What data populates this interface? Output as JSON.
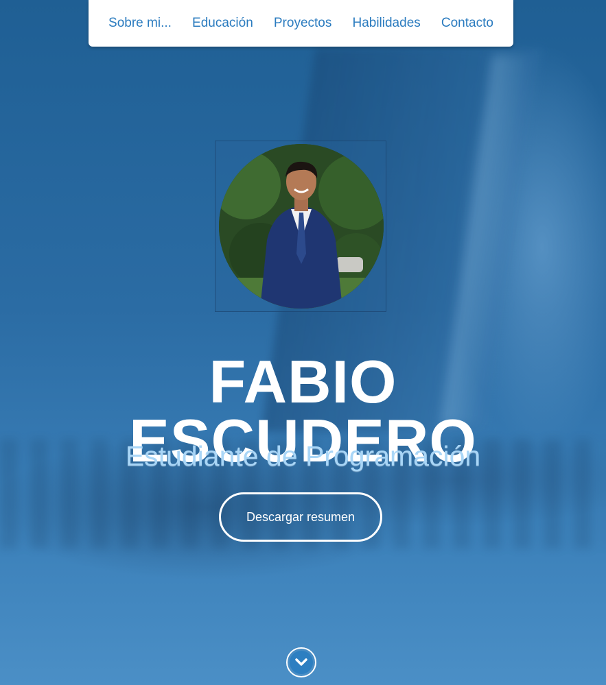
{
  "nav": {
    "items": [
      {
        "label": "Sobre mi..."
      },
      {
        "label": "Educación"
      },
      {
        "label": "Proyectos"
      },
      {
        "label": "Habilidades"
      },
      {
        "label": "Contacto"
      }
    ]
  },
  "hero": {
    "first_name": "FABIO",
    "last_name": "ESCUDERO",
    "subtitle": "Estudiante de Programación",
    "button_label": "Descargar resumen",
    "profile_icon": "profile-photo",
    "scroll_icon": "chevron-down-icon"
  },
  "colors": {
    "nav_link": "#2a7bbf",
    "subtitle": "#a9d6f7",
    "background": "#2f6fa6"
  }
}
